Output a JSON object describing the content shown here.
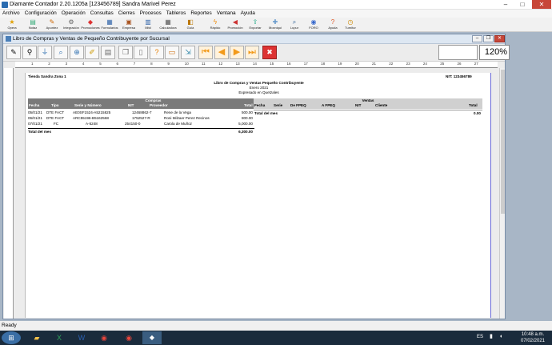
{
  "app": {
    "title": "Diamante Contador 2.20.1205a [123456789] Sandra Marivel Perez"
  },
  "menu": [
    "Archivo",
    "Configuración",
    "Operación",
    "Consultas",
    "Cierres",
    "Procesos",
    "Tableros",
    "Reportes",
    "Ventana",
    "Ayuda"
  ],
  "toolbar": [
    {
      "label": "Opera",
      "icon": "star-icon"
    },
    {
      "label": "Notaz",
      "icon": "notepad-icon"
    },
    {
      "label": "Apuntez",
      "icon": "pencil-icon"
    },
    {
      "label": "Integración",
      "icon": "gear-icon"
    },
    {
      "label": "Promociones",
      "icon": "tag-icon"
    },
    {
      "label": "Formularios",
      "icon": "form-icon"
    },
    {
      "label": "Empresa",
      "icon": "building-icon"
    },
    {
      "label": "Mitd",
      "icon": "chart-icon"
    },
    {
      "label": "Calculadora",
      "icon": "calculator-icon"
    },
    {
      "label": "Guía",
      "icon": "book-icon"
    },
    {
      "label": "Rápido",
      "icon": "bolt-icon"
    },
    {
      "label": "Promoción",
      "icon": "megaphone-icon"
    },
    {
      "label": "Exportar",
      "icon": "export-icon"
    },
    {
      "label": "Moxniqui",
      "icon": "puzzle-icon"
    },
    {
      "label": "Lupur",
      "icon": "magnifier-icon"
    },
    {
      "label": "FORO",
      "icon": "forum-icon"
    },
    {
      "label": "Ayuda",
      "icon": "help-icon"
    },
    {
      "label": "Turnitur",
      "icon": "clock-icon"
    }
  ],
  "window": {
    "title": "Libro de Compras y Ventas de Pequeño Contribuyente por Sucursal"
  },
  "zoom": "120%",
  "ruler": [
    "1",
    "2",
    "3",
    "4",
    "5",
    "6",
    "7",
    "8",
    "9",
    "10",
    "11",
    "12",
    "13",
    "14",
    "15",
    "16",
    "17",
    "18",
    "19",
    "20",
    "21",
    "22",
    "23",
    "24",
    "25",
    "26",
    "27"
  ],
  "report": {
    "branch": "Tienda Sandra Zona 1",
    "nit": "NIT: 123456789",
    "title": "Libro de Compras y Ventas Pequeño Contribuyente",
    "period": "Enero 2021",
    "currency": "Expresado en Quetzales",
    "compras_header": "Compras",
    "ventas_header": "Ventas",
    "compras_cols": [
      "Fecha",
      "Tipo",
      "Serie y Número",
      "NIT",
      "Proveedor",
      "Total"
    ],
    "ventas_cols": [
      "Fecha",
      "Serie",
      "De FPEQ",
      "A FPEQ",
      "NIT",
      "Cliente",
      "Total"
    ],
    "compras_rows": [
      {
        "fecha": "05/01/21",
        "tipo": "DTE FACT",
        "serie": "AE0SF1524-A5215825",
        "nit": "12468862-7",
        "proveedor": "Rene de la Vega",
        "total": "500.00"
      },
      {
        "fecha": "06/01/21",
        "tipo": "DTE FACT",
        "serie": "ARC55196-B5162568",
        "nit": "1752527-R",
        "proveedor": "Roni Milzaer Perez Recinos",
        "total": "800.00"
      },
      {
        "fecha": "07/01/21",
        "tipo": "FC",
        "serie": "A-5248",
        "nit": "254150-0",
        "proveedor": "Carola de Muñoz",
        "total": "5,000.00"
      }
    ],
    "compras_total_label": "Total del mes",
    "compras_total": "6,300.00",
    "ventas_total_label": "Total del mes",
    "ventas_total": "0.00"
  },
  "status": "Ready",
  "taskbar": {
    "lang": "ES",
    "time": "10:48 a.m.",
    "date": "07/02/2021",
    "apps": [
      "folder-icon",
      "excel-icon",
      "word-icon",
      "chrome-icon",
      "chrome-icon"
    ]
  }
}
